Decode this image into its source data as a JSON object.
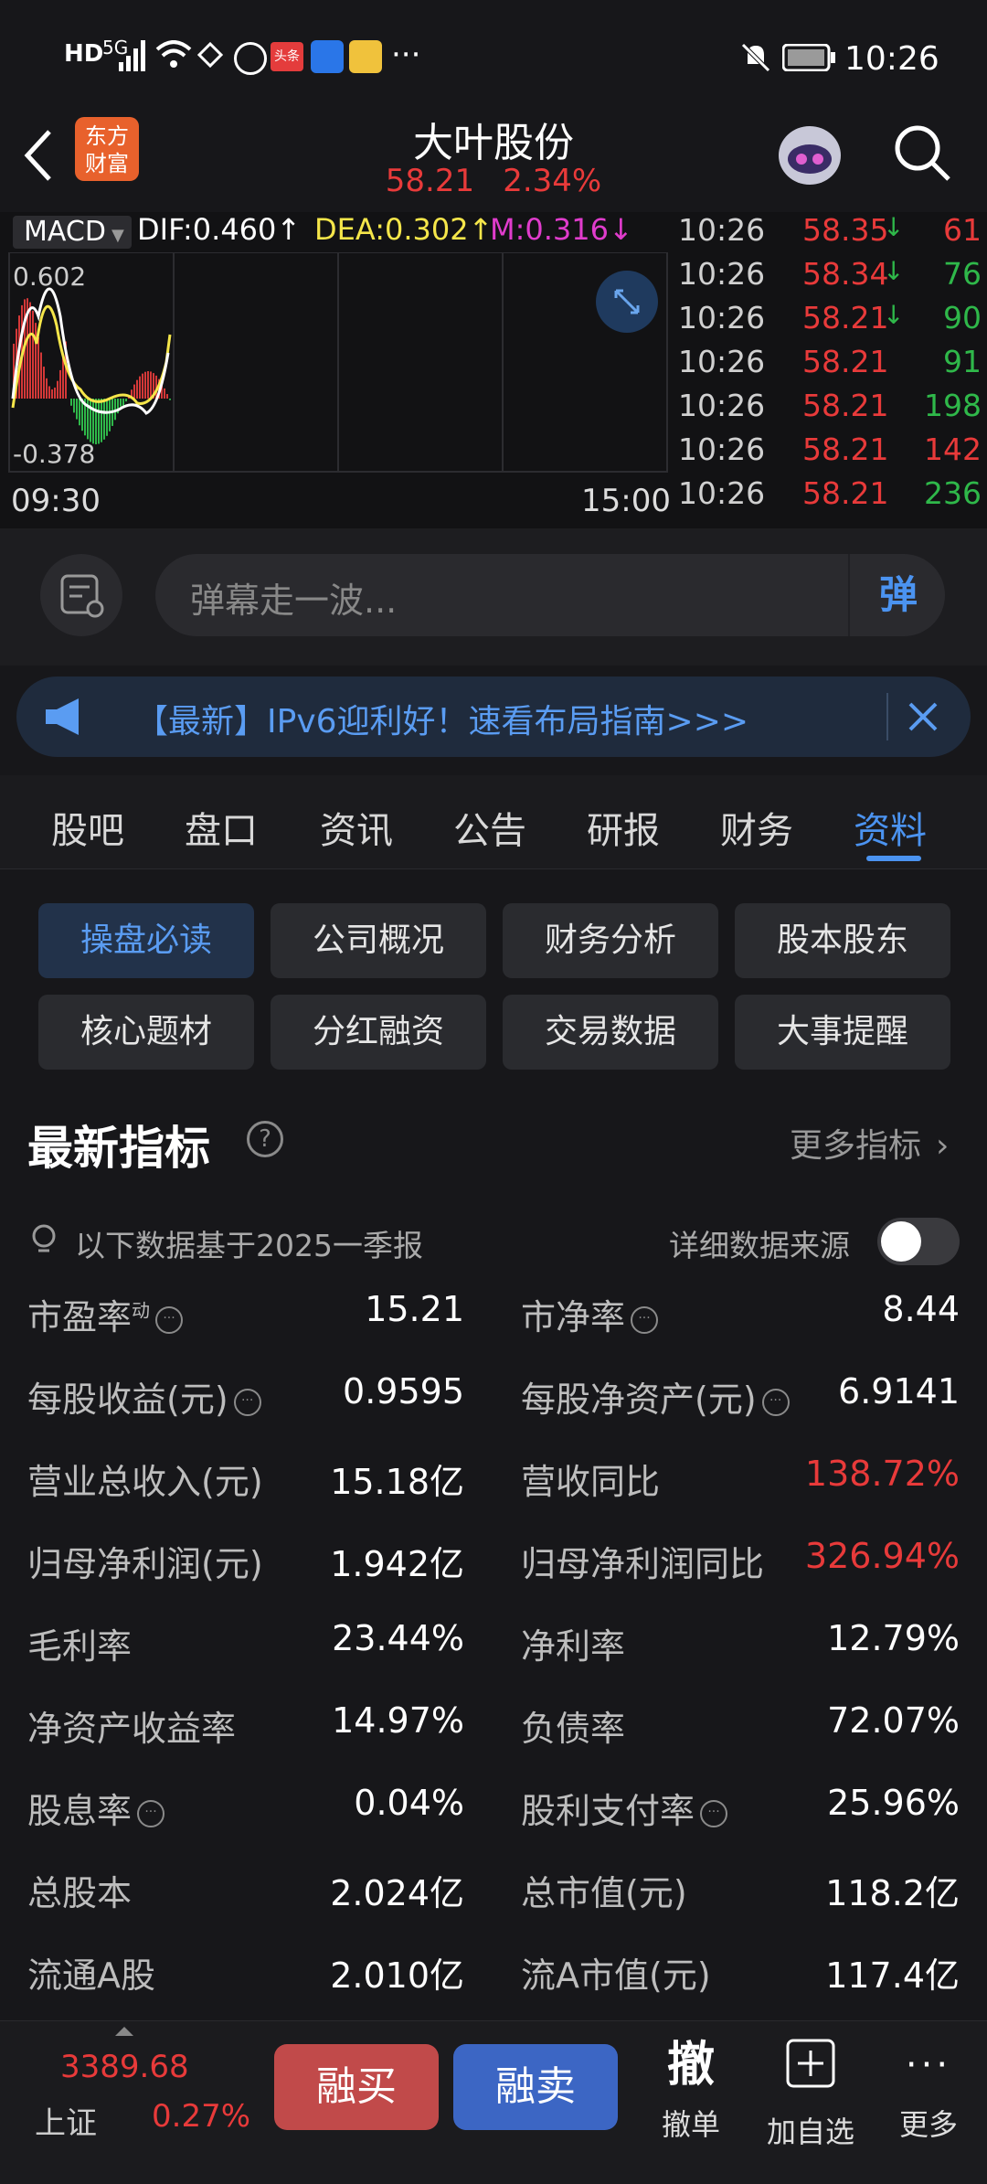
{
  "status": {
    "time": "10:26",
    "left_icons": [
      "HD",
      "5G",
      "signal-icon",
      "wifi-icon",
      "app-icons",
      "..."
    ],
    "dots": "···"
  },
  "header": {
    "title": "大叶股份",
    "price": "58.21",
    "change": "2.34%",
    "logo_line1": "东方",
    "logo_line2": "财富"
  },
  "chart": {
    "indicator": "MACD",
    "dif": "DIF:0.460",
    "dea": "DEA:0.302",
    "m": "M:0.316",
    "ymax": "0.602",
    "ymin": "-0.378",
    "t_start": "09:30",
    "t_end": "15:00"
  },
  "ticks": [
    {
      "time": "10:26",
      "price": "58.35",
      "arrow": "↓",
      "vol": "61",
      "vol_color": "#e83a3a"
    },
    {
      "time": "10:26",
      "price": "58.34",
      "arrow": "↓",
      "vol": "76",
      "vol_color": "#2fb84a"
    },
    {
      "time": "10:26",
      "price": "58.21",
      "arrow": "↓",
      "vol": "90",
      "vol_color": "#2fb84a"
    },
    {
      "time": "10:26",
      "price": "58.21",
      "arrow": "",
      "vol": "91",
      "vol_color": "#2fb84a"
    },
    {
      "time": "10:26",
      "price": "58.21",
      "arrow": "",
      "vol": "198",
      "vol_color": "#2fb84a"
    },
    {
      "time": "10:26",
      "price": "58.21",
      "arrow": "",
      "vol": "142",
      "vol_color": "#e83a3a"
    },
    {
      "time": "10:26",
      "price": "58.21",
      "arrow": "",
      "vol": "236",
      "vol_color": "#2fb84a"
    }
  ],
  "danmaku": {
    "placeholder": "弹幕走一波...",
    "send": "弹"
  },
  "notice": {
    "text": "【最新】IPv6迎利好！速看布局指南>>>"
  },
  "tabs": [
    "股吧",
    "盘口",
    "资讯",
    "公告",
    "研报",
    "财务",
    "资料"
  ],
  "active_tab": "资料",
  "subtabs": [
    [
      "操盘必读",
      "公司概况",
      "财务分析",
      "股本股东"
    ],
    [
      "核心题材",
      "分红融资",
      "交易数据",
      "大事提醒"
    ]
  ],
  "indicators": {
    "title": "最新指标",
    "more": "更多指标",
    "basis": "以下数据基于2025一季报",
    "source": "详细数据来源",
    "rows": [
      [
        {
          "label": "市盈率",
          "sup": "动",
          "info": true,
          "value": "15.21",
          "red": false
        },
        {
          "label": "市净率",
          "info": true,
          "value": "8.44",
          "red": false
        }
      ],
      [
        {
          "label": "每股收益(元)",
          "info": true,
          "value": "0.9595",
          "red": false
        },
        {
          "label": "每股净资产(元)",
          "info": true,
          "value": "6.9141",
          "red": false
        }
      ],
      [
        {
          "label": "营业总收入(元)",
          "value": "15.18亿",
          "red": false
        },
        {
          "label": "营收同比",
          "value": "138.72%",
          "red": true
        }
      ],
      [
        {
          "label": "归母净利润(元)",
          "value": "1.942亿",
          "red": false
        },
        {
          "label": "归母净利润同比",
          "value": "326.94%",
          "red": true
        }
      ],
      [
        {
          "label": "毛利率",
          "value": "23.44%",
          "red": false
        },
        {
          "label": "净利率",
          "value": "12.79%",
          "red": false
        }
      ],
      [
        {
          "label": "净资产收益率",
          "value": "14.97%",
          "red": false
        },
        {
          "label": "负债率",
          "value": "72.07%",
          "red": false
        }
      ],
      [
        {
          "label": "股息率",
          "info": true,
          "value": "0.04%",
          "red": false
        },
        {
          "label": "股利支付率",
          "info": true,
          "value": "25.96%",
          "red": false
        }
      ],
      [
        {
          "label": "总股本",
          "value": "2.024亿",
          "red": false
        },
        {
          "label": "总市值(元)",
          "value": "118.2亿",
          "red": false
        }
      ],
      [
        {
          "label": "流通A股",
          "value": "2.010亿",
          "red": false
        },
        {
          "label": "流A市值(元)",
          "value": "117.4亿",
          "red": false
        }
      ]
    ]
  },
  "bottom": {
    "index_value": "3389.68",
    "index_name": "上证",
    "index_change": "0.27%",
    "buy": "融买",
    "sell": "融卖",
    "cancel_icon": "撤",
    "cancel": "撤单",
    "add": "加自选",
    "more": "更多"
  }
}
